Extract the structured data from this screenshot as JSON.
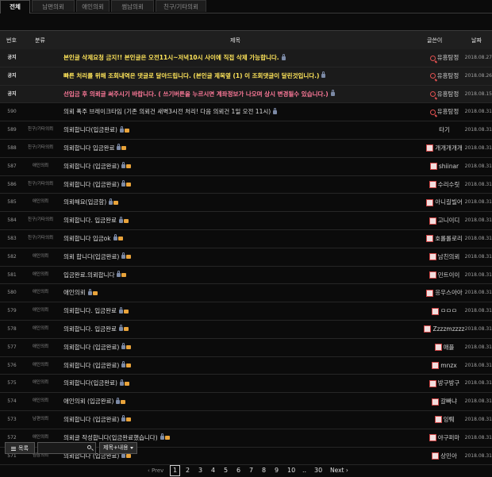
{
  "tabs": [
    {
      "label": "전체",
      "active": true
    },
    {
      "label": "남편의뢰",
      "active": false
    },
    {
      "label": "애인의뢰",
      "active": false
    },
    {
      "label": "썸남의뢰",
      "active": false
    },
    {
      "label": "친구/기타의뢰",
      "active": false
    }
  ],
  "table": {
    "headers": {
      "num": "번호",
      "category": "분류",
      "title": "제목",
      "author": "글쓴이",
      "date": "날짜"
    },
    "rows": [
      {
        "num": "공지",
        "category": "",
        "title": "본인글 삭제요청 금지!! 본인글은 오전11시~저녁10시 사이에 직접 삭제 가능합니다.",
        "style": "yellow",
        "lock": true,
        "img": false,
        "author": "유흥탐정",
        "author_icon": "magnifier",
        "date": "2018.08.27"
      },
      {
        "num": "공지",
        "category": "",
        "title": "빠른 처리를 위해 조회내역은 댓글로 달아드립니다. (본인글 제목옆 (1) 이 조회댓글이 달린것입니다.)",
        "style": "yellow",
        "lock": true,
        "img": false,
        "author": "유흥탐정",
        "author_icon": "magnifier",
        "date": "2018.08.26"
      },
      {
        "num": "공지",
        "category": "",
        "title": "선입금 후 의뢰글 써주시기 바랍니다. ( 쓰기버튼을 누르시면 계좌정보가 나오며 상시 변경될수 있습니다.)",
        "style": "pink",
        "lock": true,
        "img": false,
        "author": "유흥탐정",
        "author_icon": "magnifier",
        "date": "2018.08.15"
      },
      {
        "num": "590",
        "category": "",
        "title": "의뢰 폭주 브레이크타임 (기존 의뢰건 새벽3시전 처리! 다음 의뢰건 1일 오전 11시)",
        "style": "normal",
        "lock": true,
        "img": false,
        "author": "유흥탐정",
        "author_icon": "magnifier",
        "date": "2018.08.31"
      },
      {
        "num": "589",
        "category": "친구/기타의뢰",
        "title": "의뢰합니다(입금완료)",
        "style": "normal",
        "lock": true,
        "img": true,
        "author": "타기",
        "author_icon": "",
        "date": "2018.08.31"
      },
      {
        "num": "588",
        "category": "친구/기타의뢰",
        "title": "의뢰합니다 입금완료",
        "style": "normal",
        "lock": true,
        "img": true,
        "author": "개개개개개",
        "author_icon": "avatar",
        "date": "2018.08.31"
      },
      {
        "num": "587",
        "category": "애인의뢰",
        "title": "의뢰합니다 (입금완료)",
        "style": "normal",
        "lock": true,
        "img": true,
        "author": "shiinar",
        "author_icon": "avatar",
        "date": "2018.08.31"
      },
      {
        "num": "586",
        "category": "친구/기타의뢰",
        "title": "의뢰합니다 (입금완료)",
        "style": "normal",
        "lock": true,
        "img": true,
        "author": "수리수릿",
        "author_icon": "avatar",
        "date": "2018.08.31"
      },
      {
        "num": "585",
        "category": "애인의뢰",
        "title": "의뢰해요(입금함)",
        "style": "normal",
        "lock": true,
        "img": true,
        "author": "아니길빌어",
        "author_icon": "avatar",
        "date": "2018.08.31"
      },
      {
        "num": "584",
        "category": "친구/기타의뢰",
        "title": "의뢰합니다. 입금완료",
        "style": "normal",
        "lock": true,
        "img": true,
        "author": "고니이디",
        "author_icon": "avatar",
        "date": "2018.08.31"
      },
      {
        "num": "583",
        "category": "친구/기타의뢰",
        "title": "의뢰합니다 입금ok",
        "style": "normal",
        "lock": true,
        "img": true,
        "author": "호롤롤로리",
        "author_icon": "avatar",
        "date": "2018.08.31"
      },
      {
        "num": "582",
        "category": "애인의뢰",
        "title": "의뢰 합니다(입금완료)",
        "style": "normal",
        "lock": true,
        "img": true,
        "author": "남친의뢰",
        "author_icon": "avatar",
        "date": "2018.08.31"
      },
      {
        "num": "581",
        "category": "애인의뢰",
        "title": "입금완료.의뢰합니다",
        "style": "normal",
        "lock": true,
        "img": true,
        "author": "민트이이",
        "author_icon": "avatar",
        "date": "2018.08.31"
      },
      {
        "num": "580",
        "category": "애인의뢰",
        "title": "애인의뢰",
        "style": "normal",
        "lock": true,
        "img": true,
        "author": "응우스아아",
        "author_icon": "avatar",
        "date": "2018.08.31"
      },
      {
        "num": "579",
        "category": "애인의뢰",
        "title": "의뢰합니다. 입금완료",
        "style": "normal",
        "lock": true,
        "img": true,
        "author": "ㅁㅁㅁ",
        "author_icon": "avatar",
        "date": "2018.08.31"
      },
      {
        "num": "578",
        "category": "애인의뢰",
        "title": "의뢰합니다. 입금완료",
        "style": "normal",
        "lock": true,
        "img": true,
        "author": "Zzzzmzzzz",
        "author_icon": "avatar",
        "date": "2018.08.31"
      },
      {
        "num": "577",
        "category": "애인의뢰",
        "title": "의뢰합니다 (입금완료)",
        "style": "normal",
        "lock": true,
        "img": true,
        "author": "애플",
        "author_icon": "avatar",
        "date": "2018.08.31"
      },
      {
        "num": "576",
        "category": "애인의뢰",
        "title": "의뢰합니다 (입금완료)",
        "style": "normal",
        "lock": true,
        "img": true,
        "author": "mnzx",
        "author_icon": "avatar",
        "date": "2018.08.31"
      },
      {
        "num": "575",
        "category": "애인의뢰",
        "title": "의뢰합니다(입금완료)",
        "style": "normal",
        "lock": true,
        "img": true,
        "author": "방구방구",
        "author_icon": "avatar",
        "date": "2018.08.31"
      },
      {
        "num": "574",
        "category": "애인의뢰",
        "title": "애인의뢰 (입금완료)",
        "style": "normal",
        "lock": true,
        "img": true,
        "author": "갈빠냐",
        "author_icon": "avatar",
        "date": "2018.08.31"
      },
      {
        "num": "573",
        "category": "남편의뢰",
        "title": "의뢰합니다 (입금완료)",
        "style": "normal",
        "lock": true,
        "img": true,
        "author": "잉뤠",
        "author_icon": "avatar",
        "date": "2018.08.31"
      },
      {
        "num": "572",
        "category": "애인의뢰",
        "title": "의뢰글 작성합니다(입금완료했습니다)",
        "style": "normal",
        "lock": true,
        "img": true,
        "author": "야구퍼마",
        "author_icon": "avatar",
        "date": "2018.08.31"
      },
      {
        "num": "571",
        "category": "썸남의뢰",
        "title": "의뢰합니다 (입금완료)",
        "style": "normal",
        "lock": true,
        "img": true,
        "author": "상민아",
        "author_icon": "avatar",
        "date": "2018.08.31"
      }
    ]
  },
  "bottom": {
    "list_button": "목록",
    "search_placeholder": "",
    "search_scope": "제목+내용"
  },
  "pagination": {
    "prev": "‹ Prev",
    "pages": [
      "1",
      "2",
      "3",
      "4",
      "5",
      "6",
      "7",
      "8",
      "9",
      "10",
      "..",
      "30"
    ],
    "current": "1",
    "next": "Next ›"
  }
}
